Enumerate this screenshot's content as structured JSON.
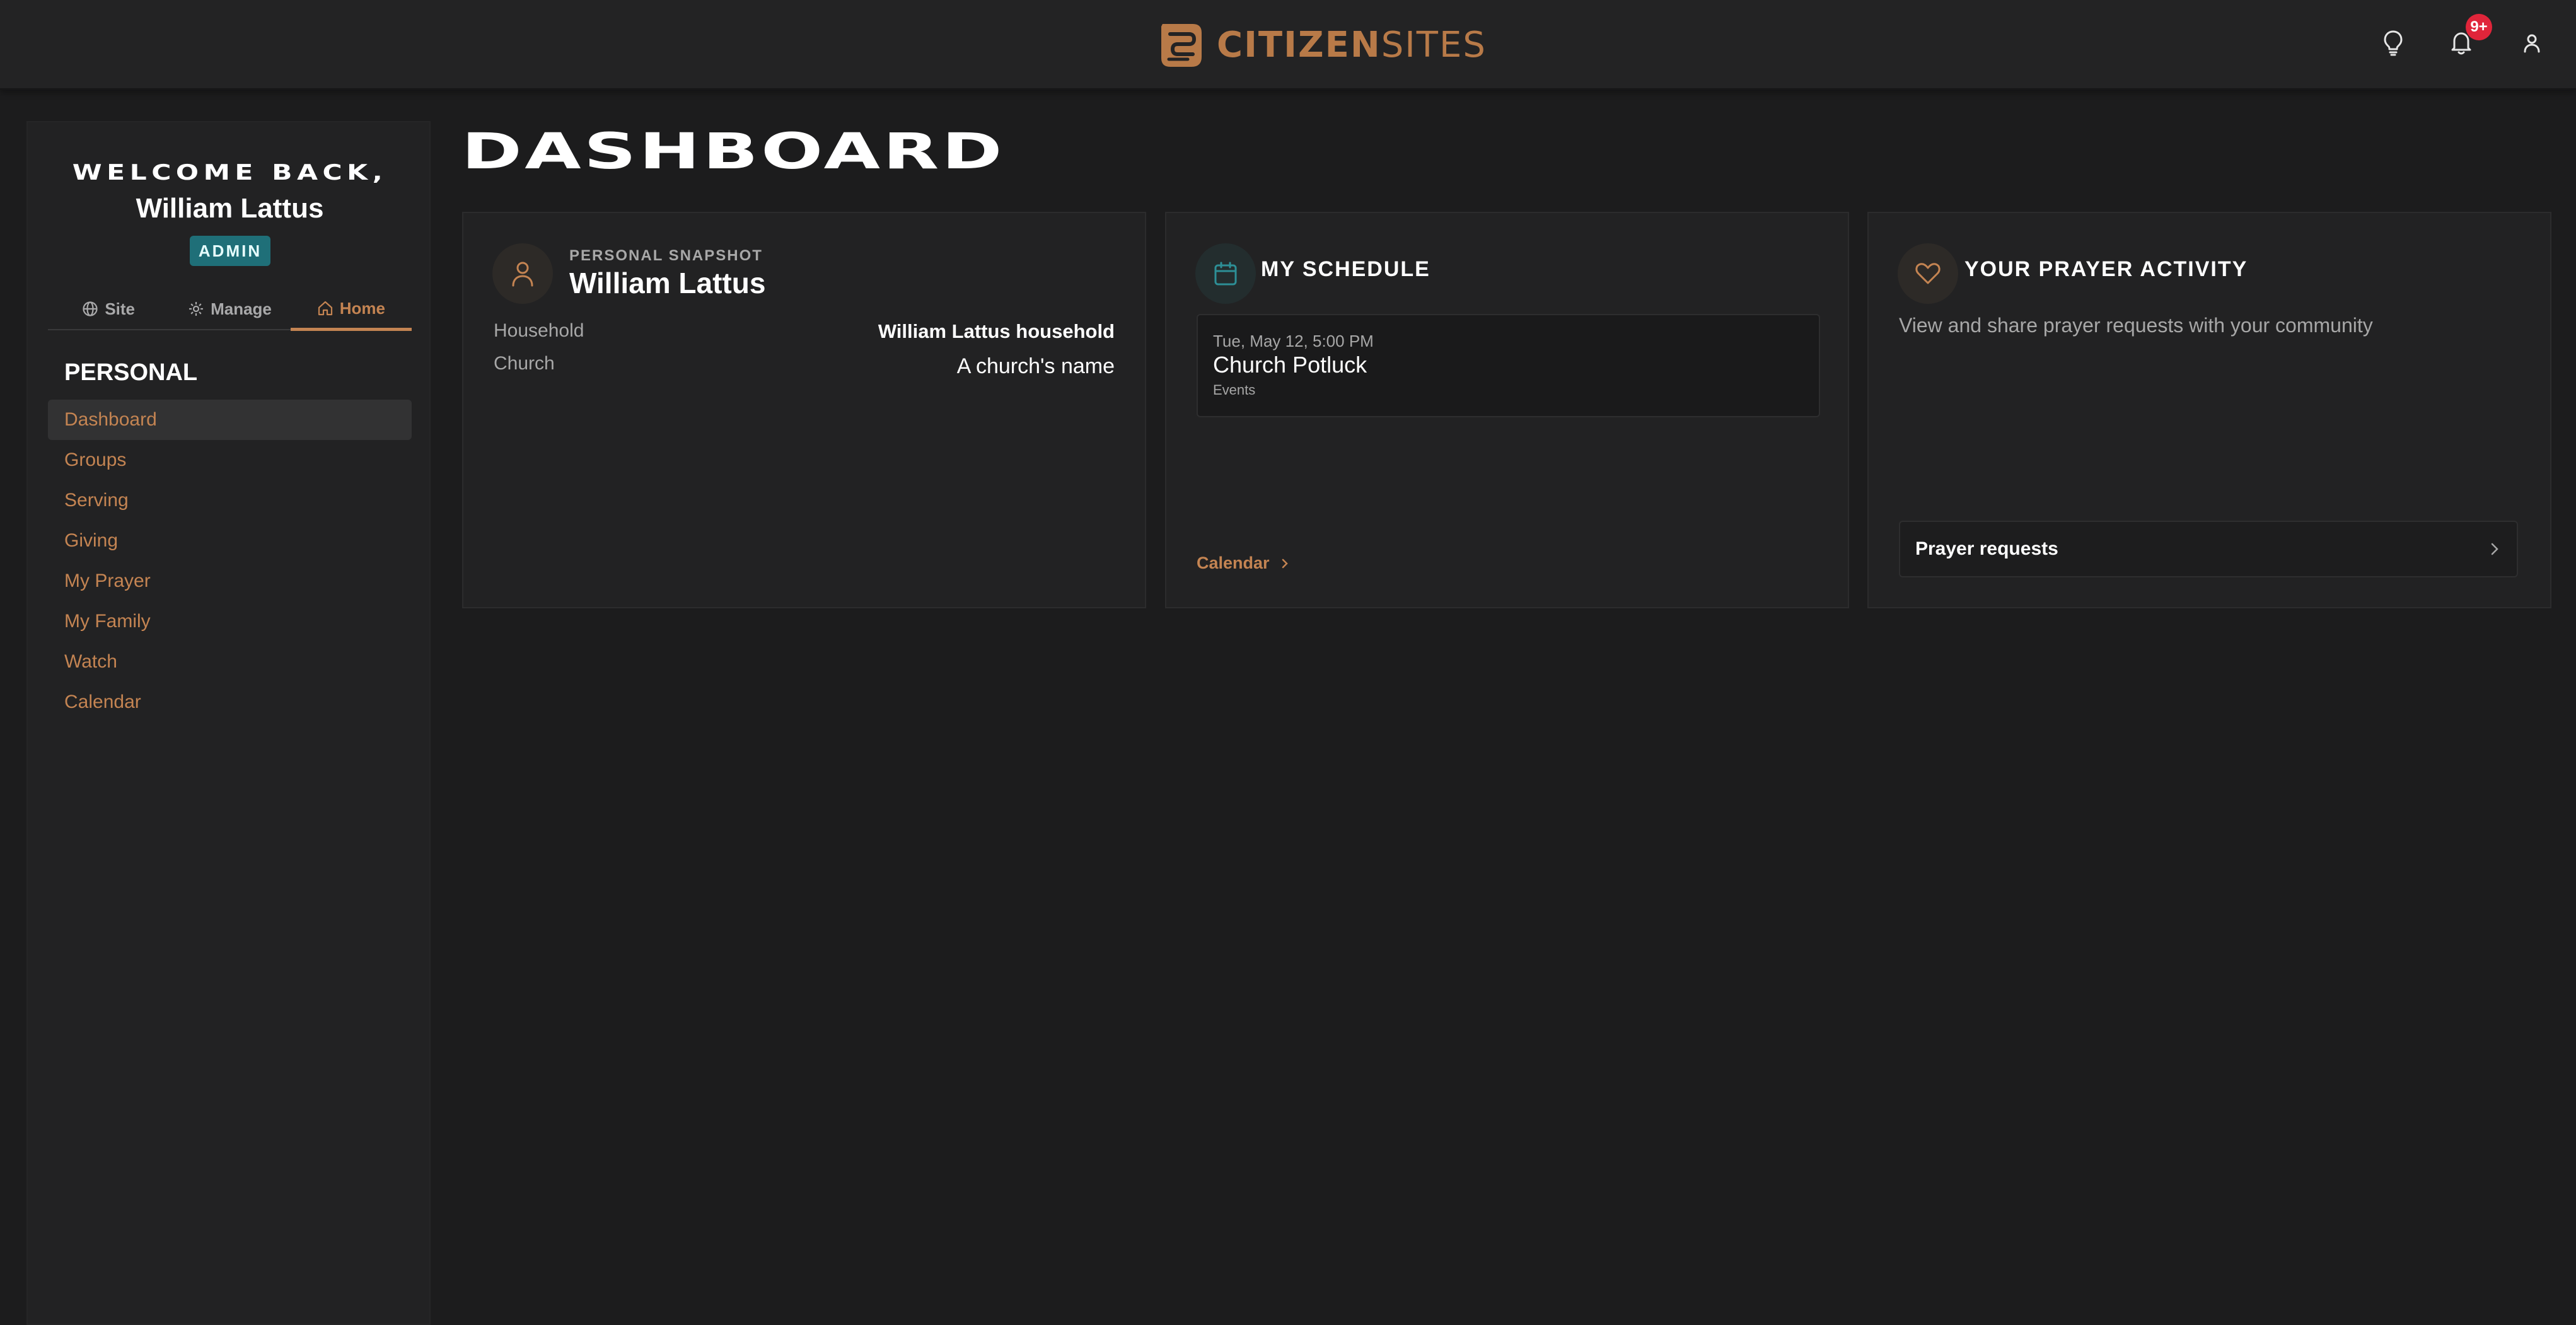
{
  "header": {
    "brand_primary": "CITIZEN",
    "brand_secondary": "SITES",
    "notification_count": "9+",
    "icons": [
      "lightbulb-icon",
      "bell-icon",
      "user-icon"
    ]
  },
  "sidebar": {
    "welcome": "WELCOME BACK,",
    "user_name": "William Lattus",
    "role": "ADMIN",
    "tabs": [
      {
        "label": "Site",
        "icon": "globe-icon"
      },
      {
        "label": "Manage",
        "icon": "gear-icon"
      },
      {
        "label": "Home",
        "icon": "home-icon",
        "active": true
      }
    ],
    "section_title": "PERSONAL",
    "nav": [
      {
        "label": "Dashboard",
        "active": true
      },
      {
        "label": "Groups"
      },
      {
        "label": "Serving"
      },
      {
        "label": "Giving"
      },
      {
        "label": "My Prayer"
      },
      {
        "label": "My Family"
      },
      {
        "label": "Watch"
      },
      {
        "label": "Calendar"
      }
    ]
  },
  "main": {
    "title": "DASHBOARD",
    "snapshot": {
      "eyebrow": "PERSONAL SNAPSHOT",
      "name": "William Lattus",
      "household_label": "Household",
      "household_value": "William Lattus household",
      "church_label": "Church",
      "church_value": "A church's name"
    },
    "schedule": {
      "heading": "MY SCHEDULE",
      "event": {
        "date": "Tue, May 12, 5:00 PM",
        "title": "Church Potluck",
        "type": "Events"
      },
      "link": "Calendar"
    },
    "prayer": {
      "heading": "YOUR PRAYER ACTIVITY",
      "description": "View and share prayer requests with your community",
      "link": "Prayer requests"
    }
  },
  "colors": {
    "accent": "#c48452",
    "admin_badge": "#1f6f78",
    "notification_badge": "#e0253a",
    "background": "#1c1c1d",
    "panel": "#222223"
  }
}
